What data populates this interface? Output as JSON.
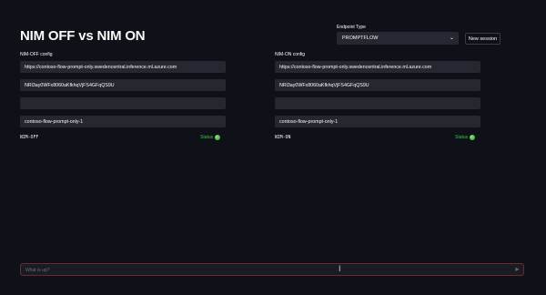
{
  "page": {
    "title": "NIM OFF vs NIM ON"
  },
  "endpoint": {
    "label": "Endpoint Type",
    "selected": "PROMPTFLOW",
    "new_session_label": "New session"
  },
  "left": {
    "config_label": "NIM-OFF config",
    "url": "https://contoso-flow-prompt-only.swedencentral.inference.ml.azure.com",
    "key": "NRl3ay0WFx8060aKfkhqVjFS4GFqQS9U",
    "field3": "",
    "deployment": "contoso-flow-prompt-only-1",
    "tag": "NIM-OFF",
    "status": "Status"
  },
  "right": {
    "config_label": "NIM-ON config",
    "url": "https://contoso-flow-prompt-only.swedencentral.inference.ml.azure.com",
    "key": "NRl3ay0WFx8060aKfkhqVjFS4GFqQS9U",
    "field3": "",
    "deployment": "contoso-flow-prompt-only-1",
    "tag": "NIM-ON",
    "status": "Status"
  },
  "chat": {
    "placeholder": "What is up?"
  },
  "colors": {
    "background": "#0e1117",
    "field": "#262730",
    "status_green": "#3ec04b",
    "chat_border": "#6b2a2e"
  },
  "icons": {
    "chevron": "chevron-down-icon",
    "send": "send-icon",
    "cursor": "text-cursor-icon"
  }
}
